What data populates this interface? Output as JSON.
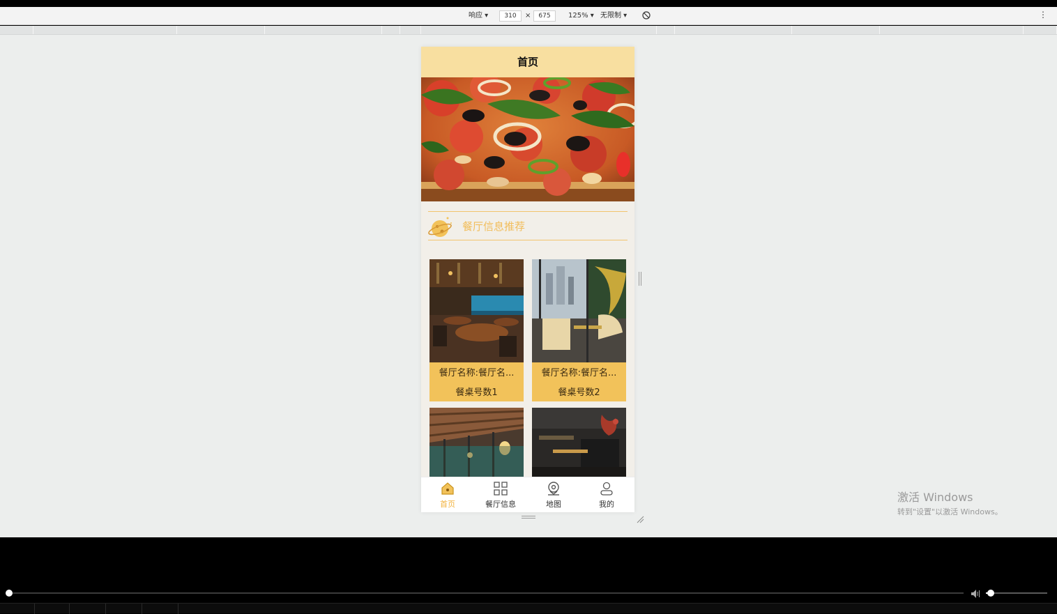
{
  "devtools": {
    "device_mode": "响应 ▾",
    "width": "310",
    "times": "×",
    "height": "675",
    "zoom": "125% ▾",
    "throttle": "无限制 ▾",
    "rotate_icon": "rotate-icon",
    "more_icon": "more-icon",
    "more_label": "⋮"
  },
  "app": {
    "page_title": "首页",
    "section_title": "餐厅信息推荐",
    "cards": [
      {
        "name": "餐厅名称:餐厅名...",
        "tables": "餐桌号数1"
      },
      {
        "name": "餐厅名称:餐厅名...",
        "tables": "餐桌号数2"
      }
    ],
    "tabs": [
      {
        "label": "首页",
        "icon": "home-icon",
        "active": true
      },
      {
        "label": "餐厅信息",
        "icon": "grid-icon",
        "active": false
      },
      {
        "label": "地图",
        "icon": "map-pin-icon",
        "active": false
      },
      {
        "label": "我的",
        "icon": "user-icon",
        "active": false
      }
    ],
    "colors": {
      "header": "#f8dfa0",
      "accent": "#f2b33e",
      "card": "#f2c25a",
      "background": "#f2efe9"
    }
  },
  "windows": {
    "activate_title": "激活 Windows",
    "activate_sub": "转到\"设置\"以激活 Windows。"
  },
  "player": {
    "seek_progress": 0.0,
    "volume": 0.08
  }
}
